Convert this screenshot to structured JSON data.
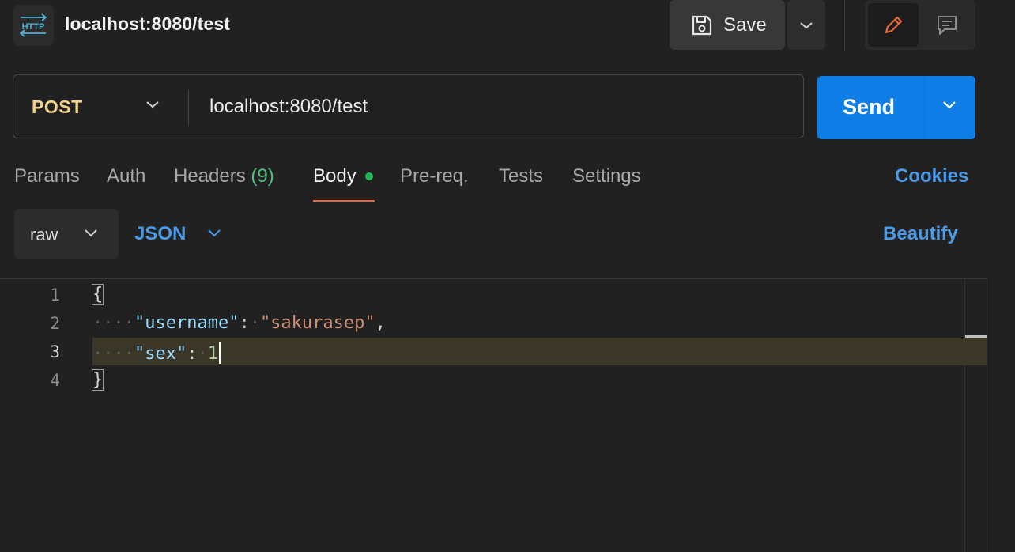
{
  "header": {
    "icon": "http-icon",
    "title": "localhost:8080/test",
    "save_label": "Save"
  },
  "request": {
    "method": "POST",
    "url": "localhost:8080/test",
    "send_label": "Send"
  },
  "tabs": {
    "params": "Params",
    "auth": "Auth",
    "headers": "Headers",
    "headers_count": "(9)",
    "body": "Body",
    "prereq": "Pre-req.",
    "tests": "Tests",
    "settings": "Settings",
    "cookies": "Cookies"
  },
  "body_toolbar": {
    "mode": "raw",
    "format": "JSON",
    "beautify": "Beautify"
  },
  "editor": {
    "line_numbers": [
      "1",
      "2",
      "3",
      "4"
    ],
    "open_brace": "{",
    "close_brace": "}",
    "line2_key": "\"username\"",
    "line2_value": "\"sakurasep\"",
    "line3_key": "\"sex\"",
    "line3_value": "1"
  },
  "colors": {
    "accent_blue": "#0e7ee6",
    "method_color": "#f1d38a",
    "active_tab_underline": "#e8683a",
    "body_dot": "#1fb954"
  }
}
